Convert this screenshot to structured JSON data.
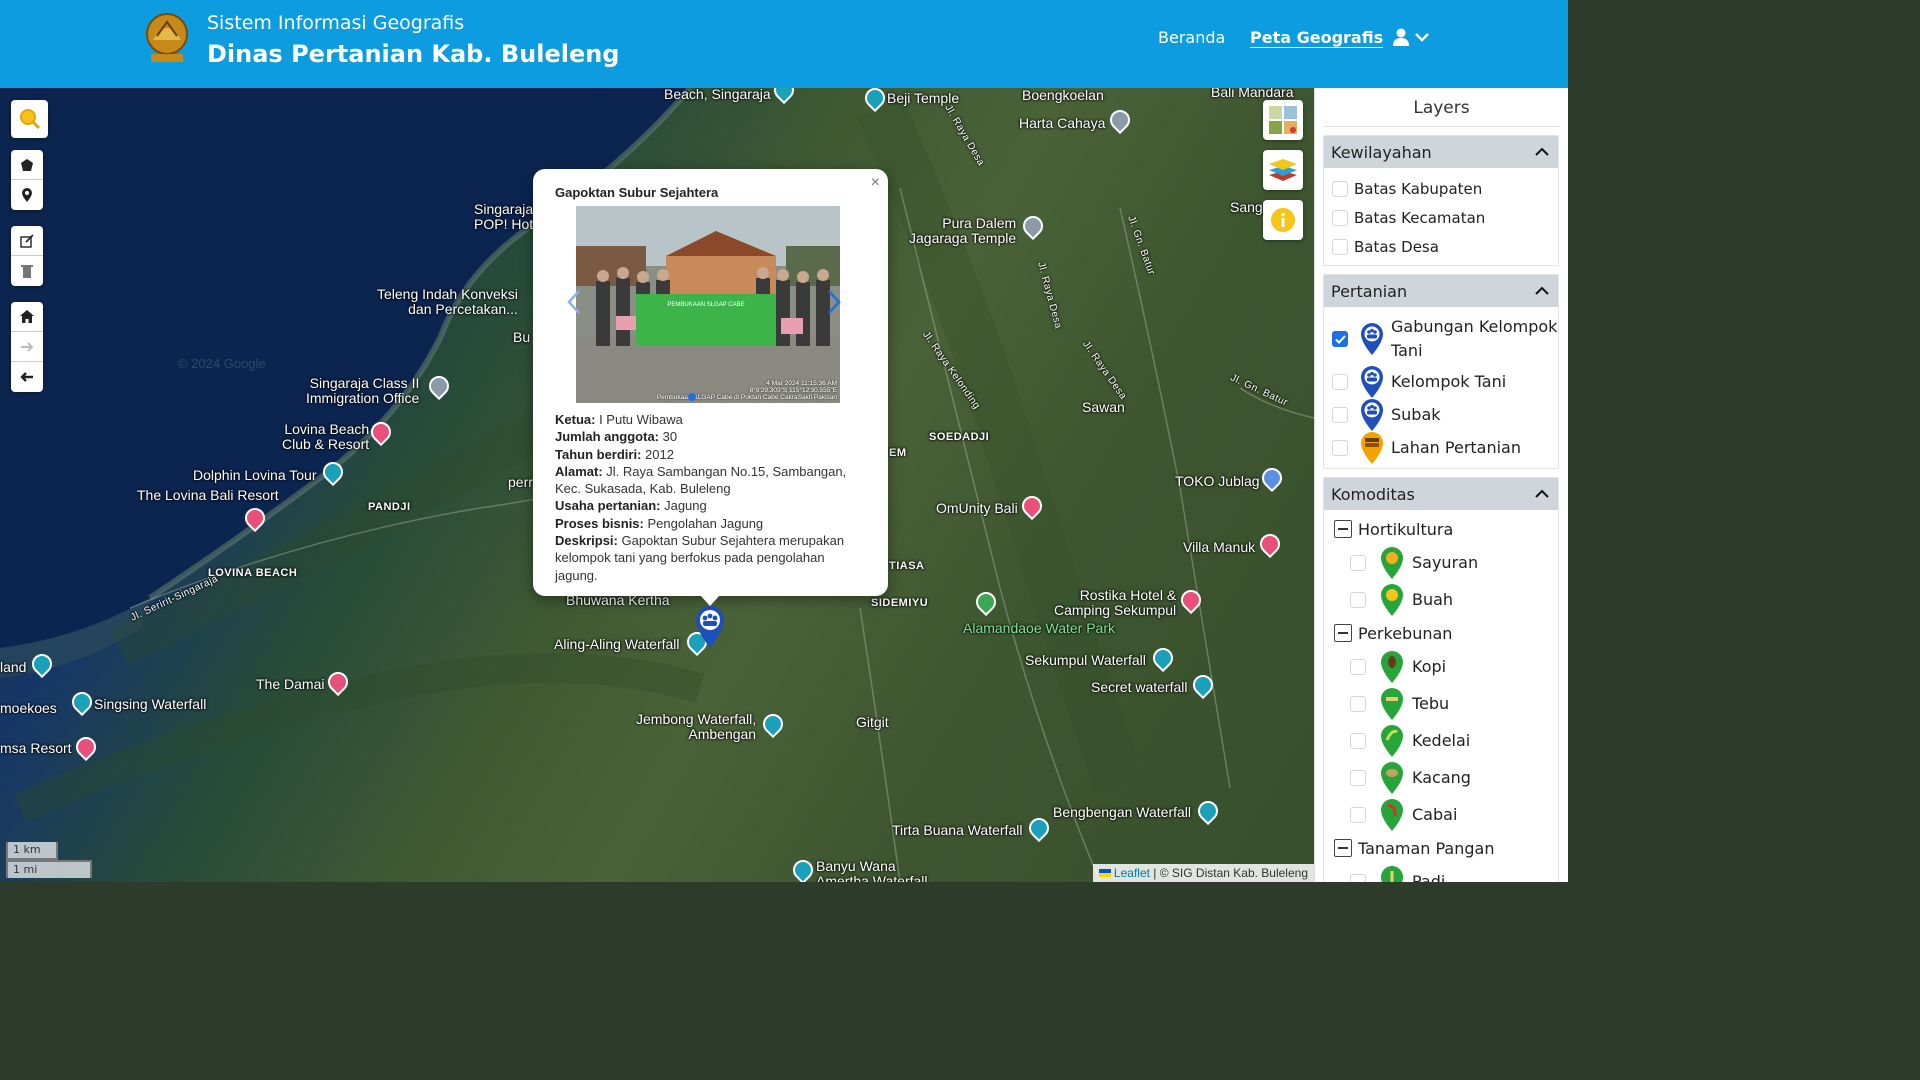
{
  "header": {
    "subtitle": "Sistem Informasi Geografis",
    "title": "Dinas Pertanian Kab. Buleleng",
    "nav": {
      "beranda": "Beranda",
      "peta": "Peta Geografis"
    }
  },
  "map": {
    "watermark": "© 2024 Google",
    "labels": {
      "beach_singaraja": "Beach, Singaraja",
      "beji_temple": "Beji Temple",
      "boengkoelan": "Boengkoelan",
      "bali_mandara": "Bali Mandara",
      "harta_cahaya": "Harta Cahaya",
      "singaraja_pop": "Singaraja\nPOP! Hot",
      "sang": "Sang",
      "pura_dalem": "Pura Dalem\nJagaraga Temple",
      "teleng": "Teleng Indah Konveksi\ndan Percetakan...",
      "bu": "Bu",
      "singaraja_class": "Singaraja Class II\nImmigration Office",
      "sawan": "Sawan",
      "soedadji": "SOEDADJI",
      "lovina_beach_club": "Lovina Beach\nClub & Resort",
      "em": "EM",
      "dolphin": "Dolphin Lovina Tour",
      "perr": "perr",
      "the_lovina": "The Lovina Bali Resort",
      "panjji": "PANDJI",
      "omunity": "OmUnity Bali",
      "toko_jublag": "TOKO Jublag",
      "villa_manuk": "Villa Manuk",
      "tiasa": "TIASA",
      "lovina_beach": "LOVINA BEACH",
      "rostika": "Rostika Hotel &\nCamping Sekumpul",
      "bhuwana": "Bhuwana Kertha",
      "sidemiyu": "SIDEMIYU",
      "alamandaoe": "Alamandaoe Water Park",
      "aling": "Aling-Aling Waterfall",
      "land": "land",
      "sekumpul": "Sekumpul Waterfall",
      "the_damai": "The Damai",
      "secret": "Secret waterfall",
      "moekoes": "moekoes",
      "singsing": "Singsing Waterfall",
      "jembong": "Jembong Waterfall,\nAmbengan",
      "gitgit": "Gitgit",
      "msa": "msa Resort",
      "bengbengan": "Bengbengan Waterfall",
      "tirta": "Tirta Buana Waterfall",
      "banyu": "Banyu Wana\nAmertha Waterfall",
      "jl_raya_desa": "Jl. Raya Desa",
      "jl_gn_batur": "Jl. Gn. Batur",
      "jl_raya_kelonding": "Jl. Raya Kelonding",
      "jl_seririt": "Jl. Seririt-Singaraja"
    },
    "scale": {
      "km": "1 km",
      "mi": "1 mi"
    },
    "attribution": {
      "leaflet": "Leaflet",
      "rest": " | © SIG Distan Kab. Buleleng"
    }
  },
  "popup": {
    "title": "Gapoktan Subur Sejahtera",
    "close": "×",
    "photo_caption": "4 Mar 2024 11:15:36 AM\n8°9'29.303\"S 115°12'30.555\"E\nPembukaan SLGAP Cabe di Poktan Cabe CakraSakti Pakisan",
    "banner": "PEMBUKAAN SLGAP CABE",
    "fields": [
      {
        "label": "Ketua:",
        "value": " I Putu Wibawa"
      },
      {
        "label": "Jumlah anggota:",
        "value": " 30"
      },
      {
        "label": "Tahun berdiri:",
        "value": " 2012"
      },
      {
        "label": "Alamat:",
        "value": " Jl. Raya Sambangan No.15, Sambangan, Kec. Sukasada, Kab. Buleleng"
      },
      {
        "label": "Usaha pertanian:",
        "value": " Jagung"
      },
      {
        "label": "Proses bisnis:",
        "value": " Pengolahan Jagung"
      },
      {
        "label": "Deskripsi:",
        "value": " Gapoktan Subur Sejahtera merupakan kelompok tani yang berfokus pada pengolahan jagung."
      }
    ]
  },
  "sidebar": {
    "title": "Layers",
    "kewilayahan": {
      "label": "Kewilayahan",
      "items": [
        "Batas Kabupaten",
        "Batas Kecamatan",
        "Batas Desa"
      ]
    },
    "pertanian": {
      "label": "Pertanian",
      "items": [
        {
          "label": "Gabungan Kelompok Tani",
          "checked": true
        },
        {
          "label": "Kelompok Tani",
          "checked": false
        },
        {
          "label": "Subak",
          "checked": false
        },
        {
          "label": "Lahan Pertanian",
          "checked": false
        }
      ]
    },
    "komoditas": {
      "label": "Komoditas",
      "groups": [
        {
          "label": "Hortikultura",
          "items": [
            "Sayuran",
            "Buah"
          ]
        },
        {
          "label": "Perkebunan",
          "items": [
            "Kopi",
            "Tebu",
            "Kedelai",
            "Kacang",
            "Cabai"
          ]
        },
        {
          "label": "Tanaman Pangan",
          "items": [
            "Padi"
          ]
        }
      ]
    }
  },
  "colors": {
    "header": "#0d9ce0",
    "accent": "#1e6fe0",
    "section_head": "#cfd5db",
    "pin_blue": "#1f4fb8",
    "pin_orange": "#f5a300",
    "pin_green": "#27a43a"
  }
}
